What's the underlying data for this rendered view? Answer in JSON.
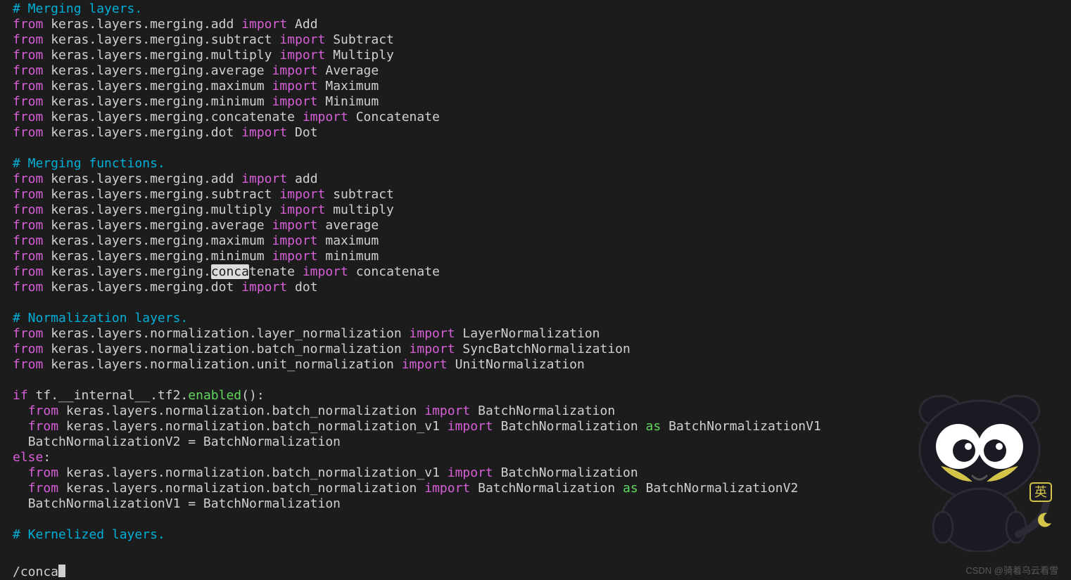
{
  "comments": {
    "merging_layers": "# Merging layers.",
    "merging_functions": "# Merging functions.",
    "normalization_layers": "# Normalization layers.",
    "kernelized_layers": "# Kernelized layers."
  },
  "kw": {
    "from": "from",
    "import": "import",
    "if": "if",
    "else": "else",
    "as": "as"
  },
  "imports": {
    "merging_layers": [
      {
        "module": "keras.layers.merging.add",
        "name": "Add"
      },
      {
        "module": "keras.layers.merging.subtract",
        "name": "Subtract"
      },
      {
        "module": "keras.layers.merging.multiply",
        "name": "Multiply"
      },
      {
        "module": "keras.layers.merging.average",
        "name": "Average"
      },
      {
        "module": "keras.layers.merging.maximum",
        "name": "Maximum"
      },
      {
        "module": "keras.layers.merging.minimum",
        "name": "Minimum"
      },
      {
        "module": "keras.layers.merging.concatenate",
        "name": "Concatenate"
      },
      {
        "module": "keras.layers.merging.dot",
        "name": "Dot"
      }
    ],
    "merging_functions": [
      {
        "module": "keras.layers.merging.add",
        "name": "add"
      },
      {
        "module": "keras.layers.merging.subtract",
        "name": "subtract"
      },
      {
        "module": "keras.layers.merging.multiply",
        "name": "multiply"
      },
      {
        "module": "keras.layers.merging.average",
        "name": "average"
      },
      {
        "module": "keras.layers.merging.maximum",
        "name": "maximum"
      },
      {
        "module": "keras.layers.merging.minimum",
        "name": "minimum"
      },
      {
        "module_pre": "keras.layers.merging.",
        "module_hi": "conca",
        "module_post": "tenate",
        "name": "concatenate"
      },
      {
        "module": "keras.layers.merging.dot",
        "name": "dot"
      }
    ],
    "normalization_layers": [
      {
        "module": "keras.layers.normalization.layer_normalization",
        "name": "LayerNormalization"
      },
      {
        "module": "keras.layers.normalization.batch_normalization",
        "name": "SyncBatchNormalization"
      },
      {
        "module": "keras.layers.normalization.unit_normalization",
        "name": "UnitNormalization"
      }
    ]
  },
  "ifblock": {
    "cond_left": "tf.__internal__.tf2.",
    "cond_fn": "enabled",
    "cond_right": "():",
    "then": [
      {
        "module": "keras.layers.normalization.batch_normalization",
        "name": "BatchNormalization"
      },
      {
        "module": "keras.layers.normalization.batch_normalization_v1",
        "name": "BatchNormalization",
        "as": "BatchNormalizationV1"
      }
    ],
    "then_assign": "BatchNormalizationV2 = BatchNormalization",
    "else_kw": "else",
    "colon": ":",
    "else_": [
      {
        "module": "keras.layers.normalization.batch_normalization_v1",
        "name": "BatchNormalization"
      },
      {
        "module": "keras.layers.normalization.batch_normalization",
        "name": "BatchNormalization",
        "as": "BatchNormalizationV2"
      }
    ],
    "else_assign": "BatchNormalizationV1 = BatchNormalization"
  },
  "status": {
    "search": "/conca"
  },
  "character_label": "英",
  "watermark": "CSDN @骑着乌云看雪"
}
